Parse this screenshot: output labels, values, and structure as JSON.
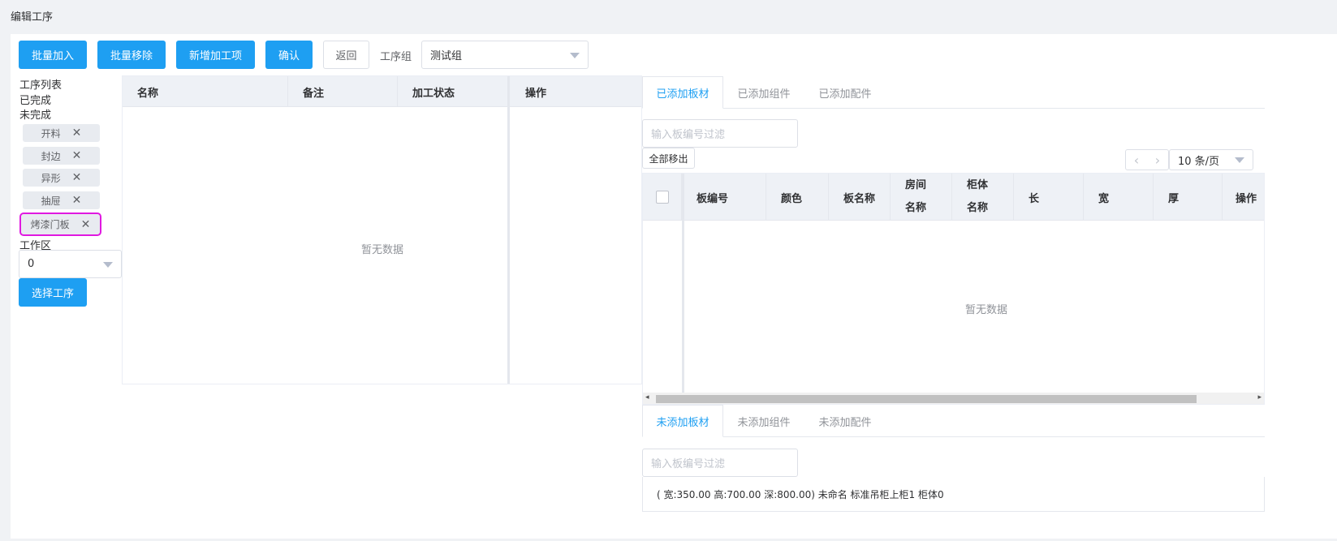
{
  "page_title": "编辑工序",
  "toolbar": {
    "batch_add": "批量加入",
    "batch_remove": "批量移除",
    "add_process_item": "新增加工项",
    "confirm": "确认",
    "back": "返回",
    "group_label": "工序组",
    "group_value": "测试组"
  },
  "sidebar": {
    "list_title": "工序列表",
    "done": "已完成",
    "undone": "未完成",
    "tags": [
      {
        "label": "开料"
      },
      {
        "label": "封边"
      },
      {
        "label": "异形"
      },
      {
        "label": "抽屉"
      },
      {
        "label": "烤漆门板"
      }
    ],
    "workzone_label": "工作区",
    "workzone_value": "0",
    "select_process_button": "选择工序"
  },
  "process_table": {
    "columns": [
      "名称",
      "备注",
      "加工状态",
      "操作"
    ],
    "empty_text": "暂无数据"
  },
  "top_tabs": {
    "items": [
      "已添加板材",
      "已添加组件",
      "已添加配件"
    ],
    "active_index": 0
  },
  "board_filter": {
    "placeholder": "输入板编号过滤"
  },
  "remove_all_button": "全部移出",
  "pagination": {
    "prev": "‹",
    "next": "›",
    "page_size": "10 条/页"
  },
  "board_table": {
    "columns": [
      "板编号",
      "颜色",
      "板名称",
      "房间名称",
      "柜体名称",
      "长",
      "宽",
      "厚",
      "操作"
    ],
    "empty_text": "暂无数据"
  },
  "bottom_tabs": {
    "items": [
      "未添加板材",
      "未添加组件",
      "未添加配件"
    ],
    "active_index": 0
  },
  "bottom_filter": {
    "placeholder": "输入板编号过滤"
  },
  "tree_item": "( 宽:350.00 高:700.00 深:800.00) 未命名 标准吊柜上柜1 柜体0",
  "colors": {
    "primary": "#1e9ff2",
    "selected_outline": "#e019e0",
    "header_bg": "#eef1f6"
  }
}
